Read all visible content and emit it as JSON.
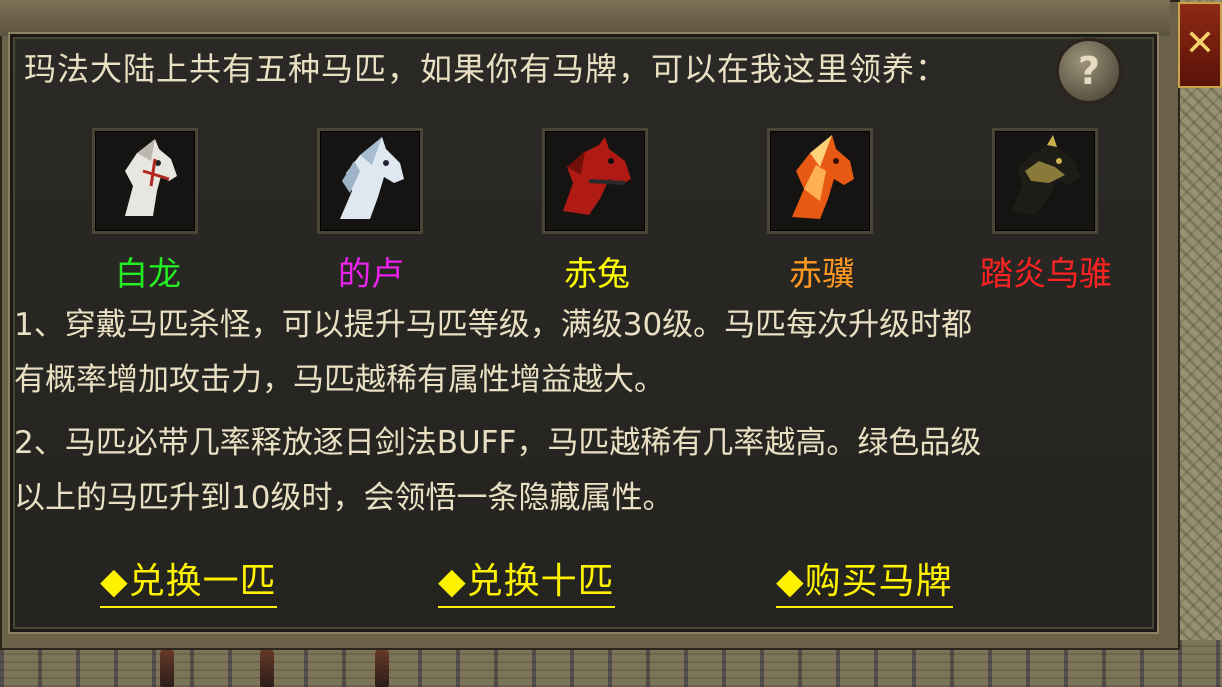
{
  "dialog": {
    "intro": "玛法大陆上共有五种马匹，如果你有马牌，可以在我这里领养：",
    "help_label": "?",
    "close_label": "✕"
  },
  "horses": [
    {
      "name": "白龙",
      "color": "#22ee22",
      "icon": "white-horse-icon"
    },
    {
      "name": "的卢",
      "color": "#ee22ee",
      "icon": "silver-horse-icon"
    },
    {
      "name": "赤兔",
      "color": "#ffff00",
      "icon": "red-horse-icon"
    },
    {
      "name": "赤骥",
      "color": "#ff9922",
      "icon": "flame-horse-icon"
    },
    {
      "name": "踏炎乌骓",
      "color": "#ff2222",
      "icon": "black-gold-horse-icon"
    }
  ],
  "paragraphs": {
    "p1_line1": "1、穿戴马匹杀怪，可以提升马匹等级，满级30级。马匹每次升级时都",
    "p1_line2": "有概率增加攻击力，马匹越稀有属性增益越大。",
    "p2_line1": "2、马匹必带几率释放逐日剑法BUFF，马匹越稀有几率越高。绿色品级",
    "p2_line2": "以上的马匹升到10级时，会领悟一条隐藏属性。"
  },
  "actions": {
    "exchange_one": "◆兑换一匹",
    "exchange_ten": "◆兑换十匹",
    "buy_token": "◆购买马牌"
  }
}
